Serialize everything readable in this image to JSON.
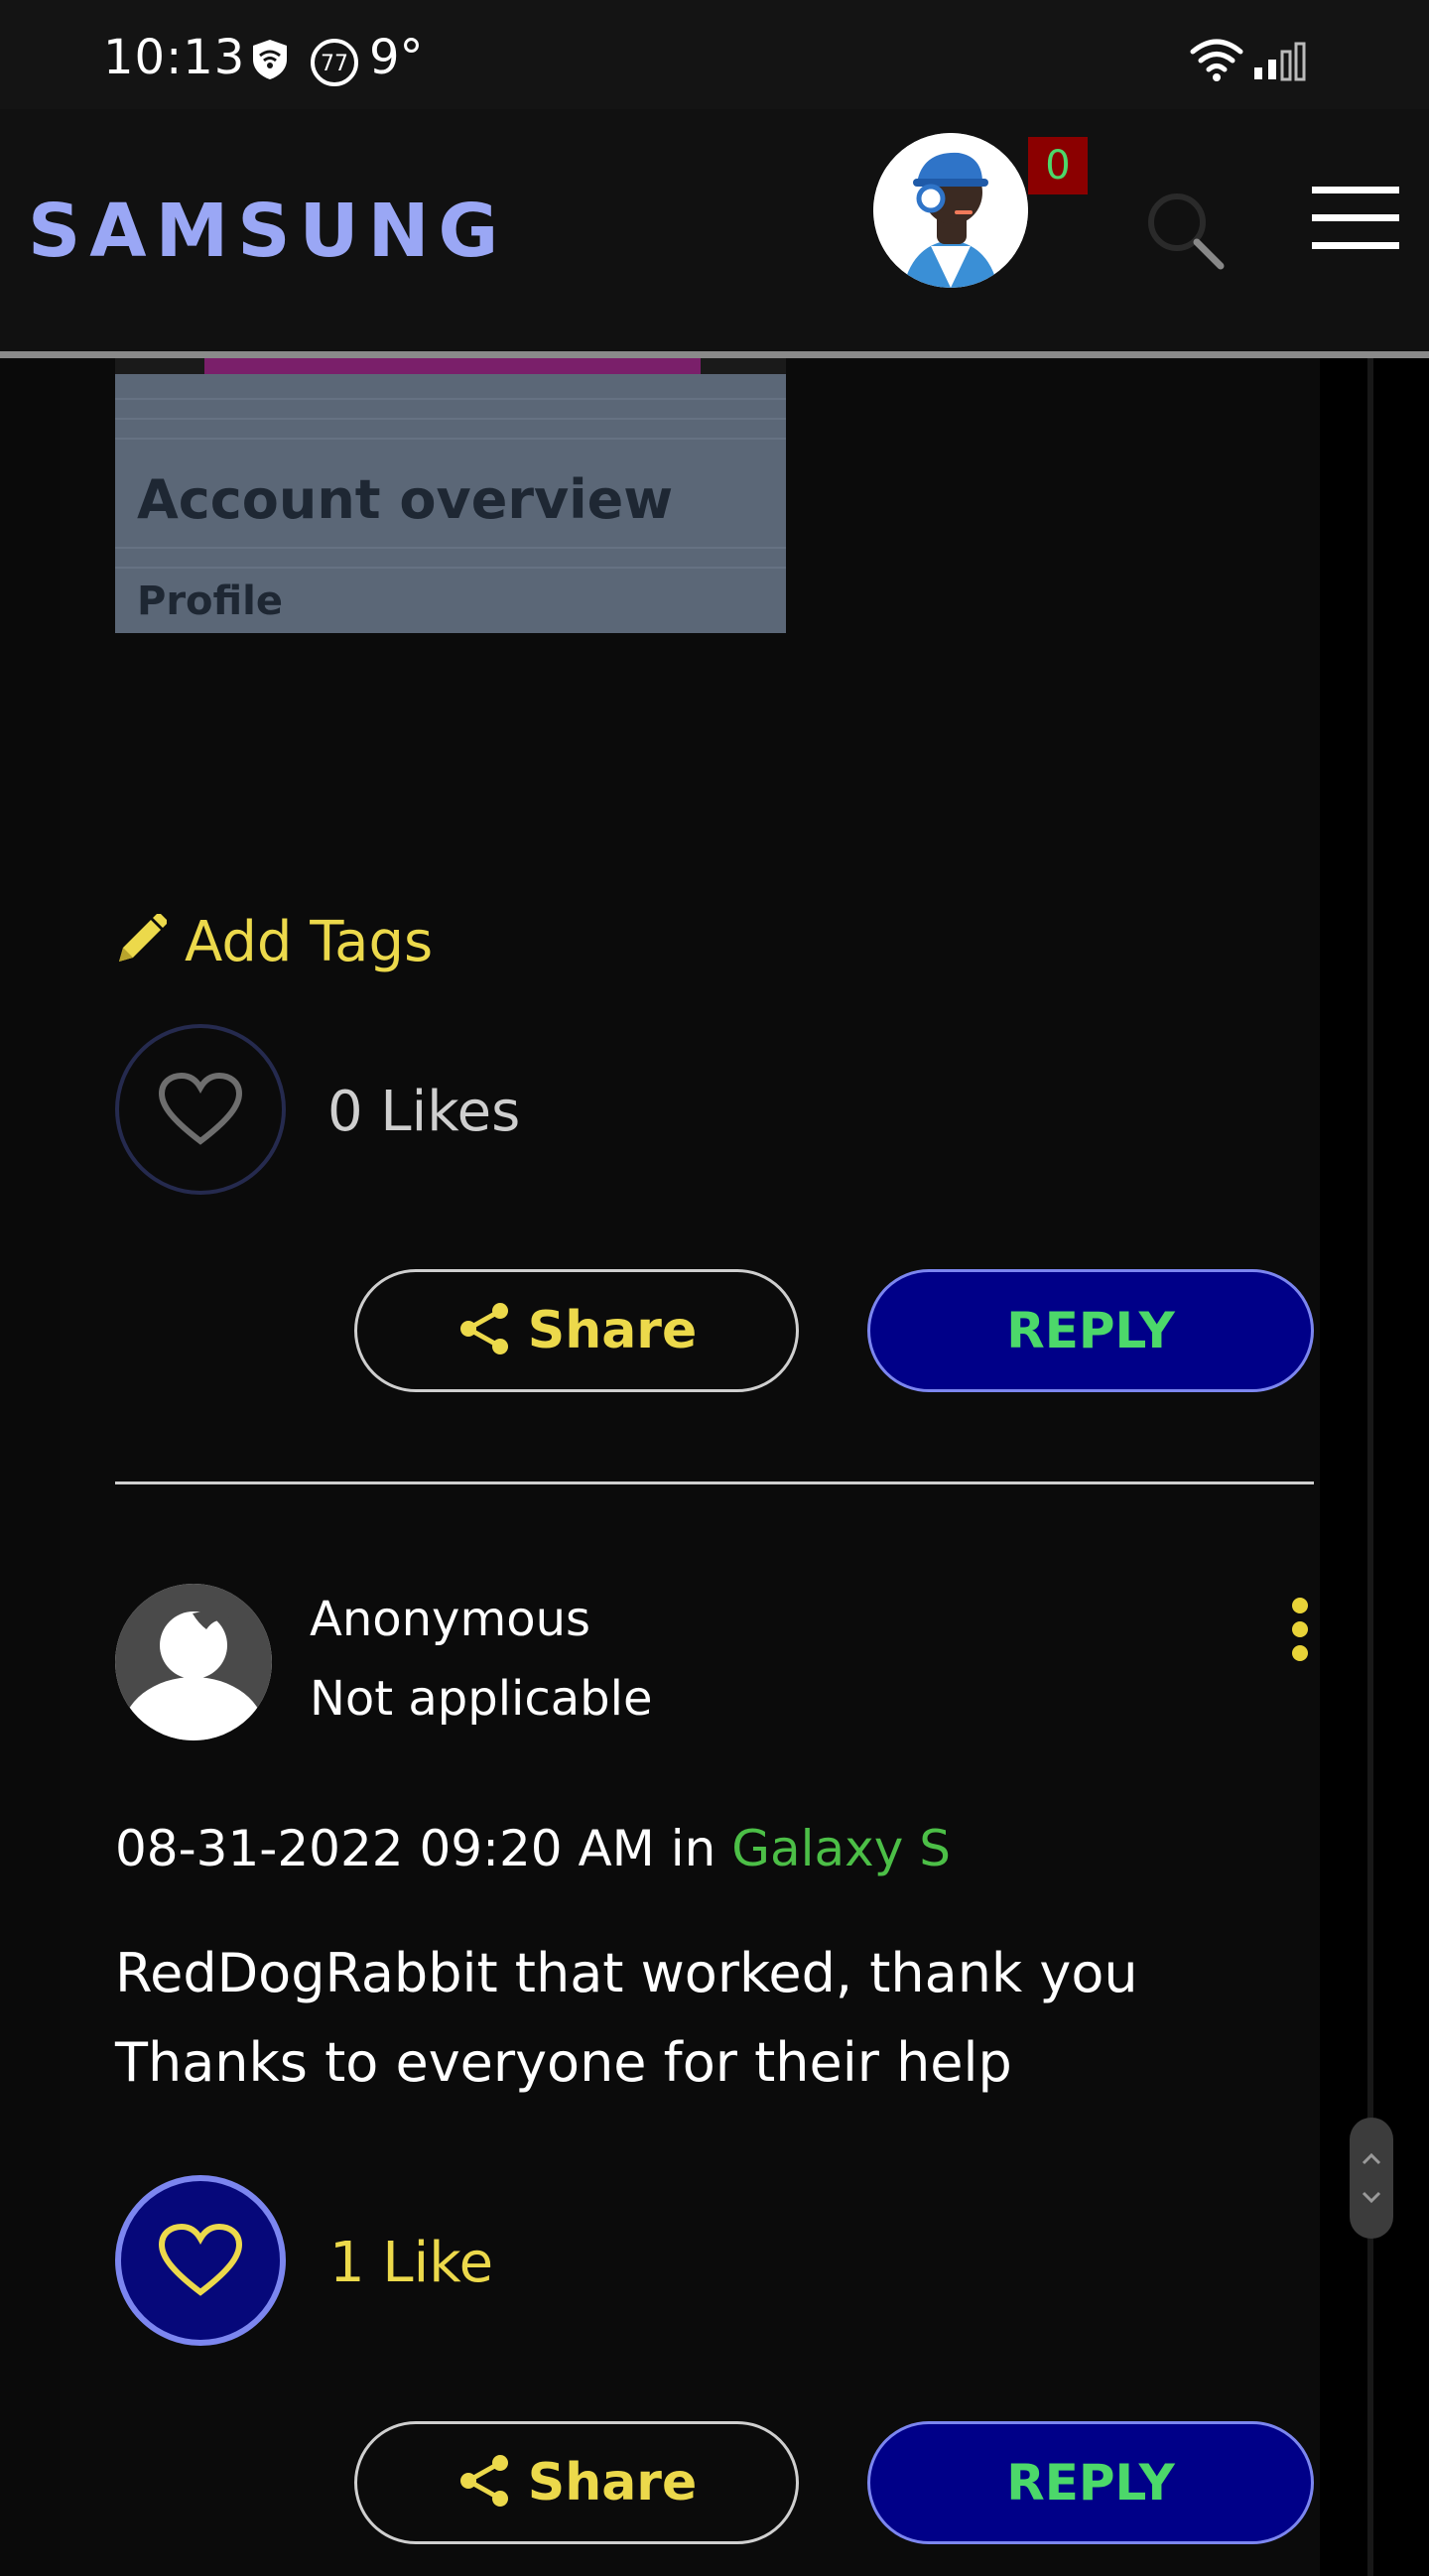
{
  "status_bar": {
    "time": "10:13",
    "badge_number": "77",
    "temperature": "9°"
  },
  "header": {
    "logo": "SAMSUNG",
    "notification_count": "0"
  },
  "first_post": {
    "image_title": "Account overview",
    "image_subtitle": "Profile",
    "add_tags_label": "Add Tags",
    "likes_label": "0 Likes",
    "share_label": "Share",
    "reply_label": "REPLY"
  },
  "second_post": {
    "author": "Anonymous",
    "role": "Not applicable",
    "date": "08-31-2022 09:20 AM",
    "in_word": "in",
    "board": "Galaxy S",
    "body_line1": "RedDogRabbit that worked, thank you",
    "body_line2": "Thanks to everyone for their help",
    "likes_label": "1 Like",
    "share_label": "Share",
    "reply_label": "REPLY"
  },
  "colors": {
    "accent_yellow": "#ecd94b",
    "accent_green": "#4cd86a",
    "reply_blue": "#000088",
    "logo_blue": "#9aa7f5",
    "notification_red": "#8b0000"
  }
}
